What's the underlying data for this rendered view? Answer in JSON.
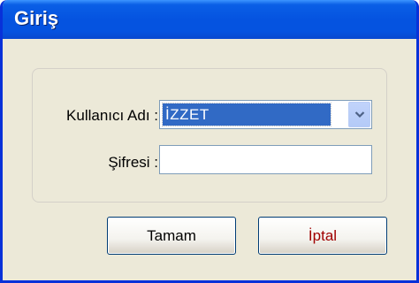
{
  "window": {
    "title": "Giriş"
  },
  "form": {
    "username_label": "Kullanıcı Adı :",
    "username_value": "İZZET",
    "password_label": "Şifresi :",
    "password_value": ""
  },
  "buttons": {
    "ok_label": "Tamam",
    "cancel_label": "İptal"
  },
  "colors": {
    "titlebar": "#0553e0",
    "selection": "#316ac5",
    "cancel_text": "#a00000"
  },
  "icons": {
    "dropdown": "chevron-down-icon"
  }
}
